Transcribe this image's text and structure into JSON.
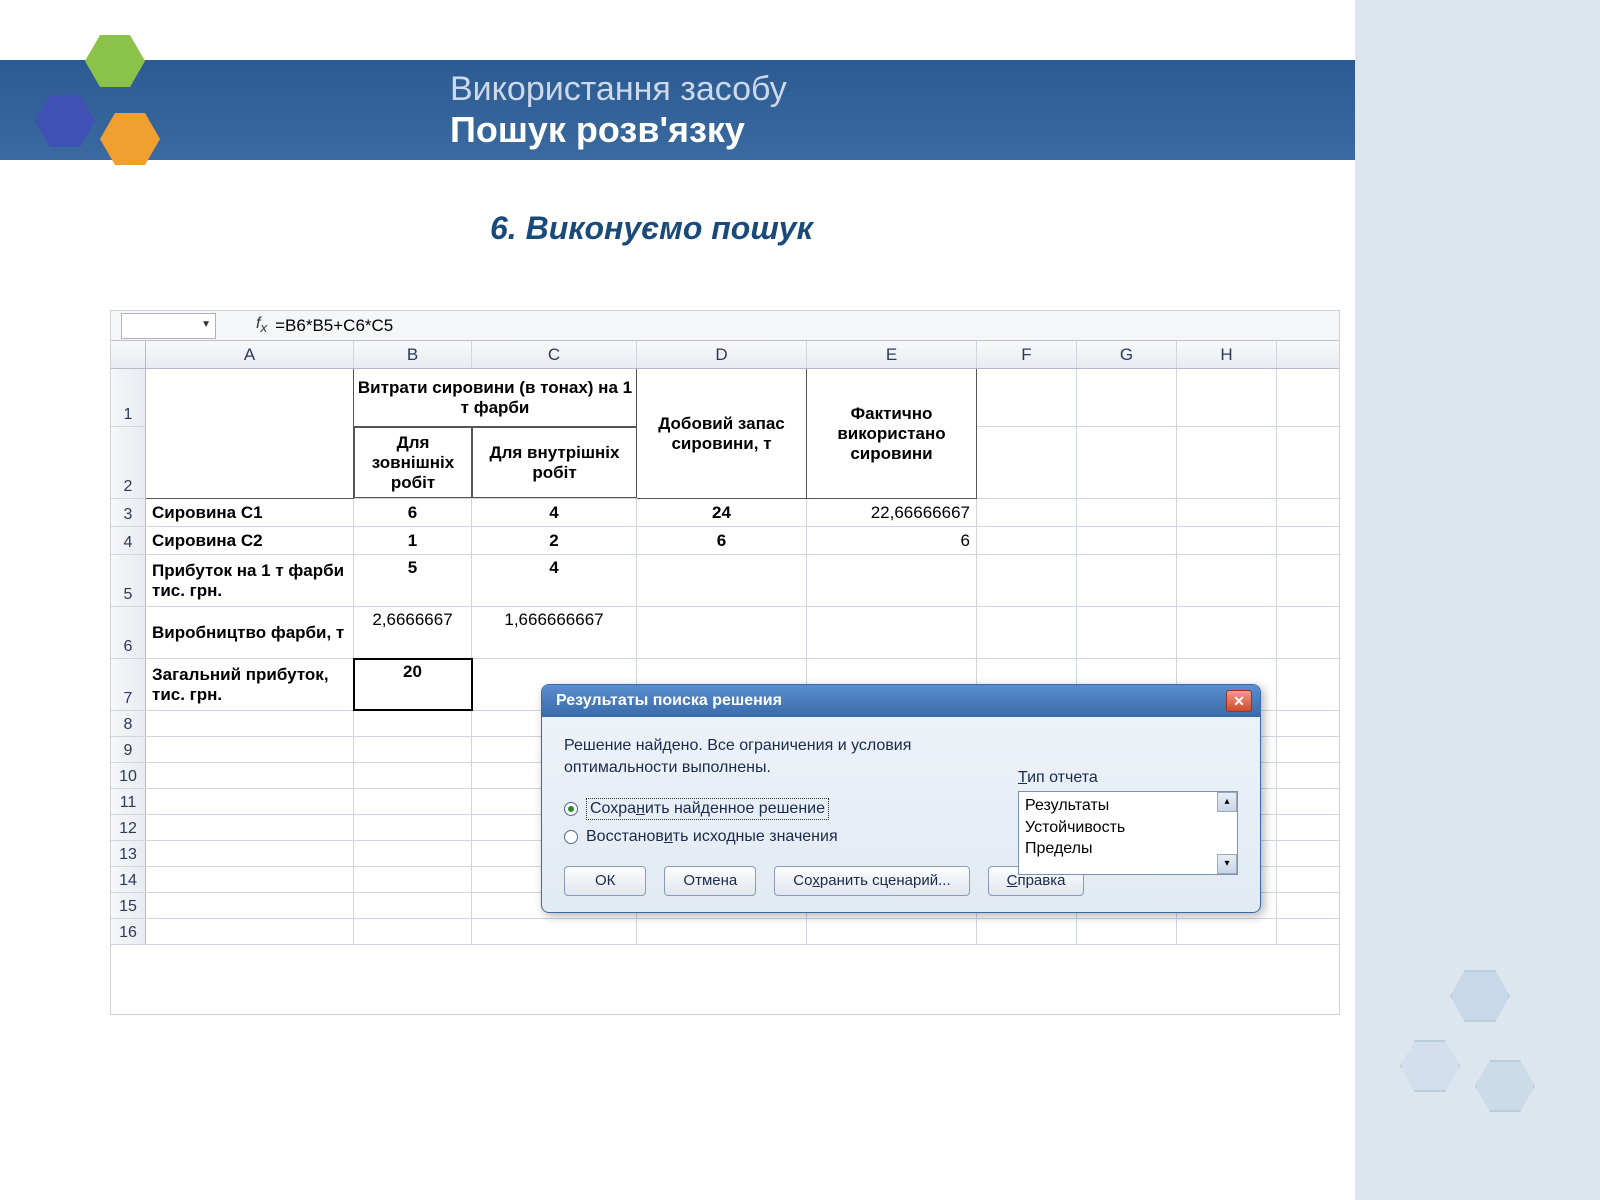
{
  "slide": {
    "title_line1": "Використання засобу",
    "title_line2": "Пошук розв'язку",
    "subtitle": "6. Виконуємо пошук"
  },
  "excel": {
    "formula": "=B6*B5+C6*C5",
    "columns": [
      "A",
      "B",
      "C",
      "D",
      "E",
      "F",
      "G",
      "H"
    ],
    "header_BC": "Витрати сировини (в тонах) на 1 т фарби",
    "header_B2": "Для зовнішніх робіт",
    "header_C2": "Для внутрішніх робіт",
    "header_D": "Добовий запас сировини, т",
    "header_E": "Фактично використано сировини",
    "rows": {
      "r3": {
        "A": "Сировина С1",
        "B": "6",
        "C": "4",
        "D": "24",
        "E": "22,66666667"
      },
      "r4": {
        "A": "Сировина С2",
        "B": "1",
        "C": "2",
        "D": "6",
        "E": "6"
      },
      "r5": {
        "A": "Прибуток на 1 т фарби тис. грн.",
        "B": "5",
        "C": "4"
      },
      "r6": {
        "A": "Виробництво фарби, т",
        "B": "2,6666667",
        "C": "1,666666667"
      },
      "r7": {
        "A": "Загальний прибуток, тис. грн.",
        "B": "20"
      }
    },
    "row_numbers": [
      "1",
      "2",
      "3",
      "4",
      "5",
      "6",
      "7",
      "8",
      "9",
      "10",
      "11",
      "12",
      "13",
      "14",
      "15",
      "16"
    ]
  },
  "dialog": {
    "title": "Результаты поиска решения",
    "message_l1": "Решение найдено. Все ограничения и условия",
    "message_l2": "оптимальности выполнены.",
    "radio_save": "Сохранить найденное решение",
    "radio_restore": "Восстановить исходные значения",
    "report_label": "Тип отчета",
    "report_options": [
      "Результаты",
      "Устойчивость",
      "Пределы"
    ],
    "buttons": {
      "ok": "ОК",
      "cancel": "Отмена",
      "save_scenario": "Сохранить сценарий...",
      "help": "Справка"
    }
  }
}
